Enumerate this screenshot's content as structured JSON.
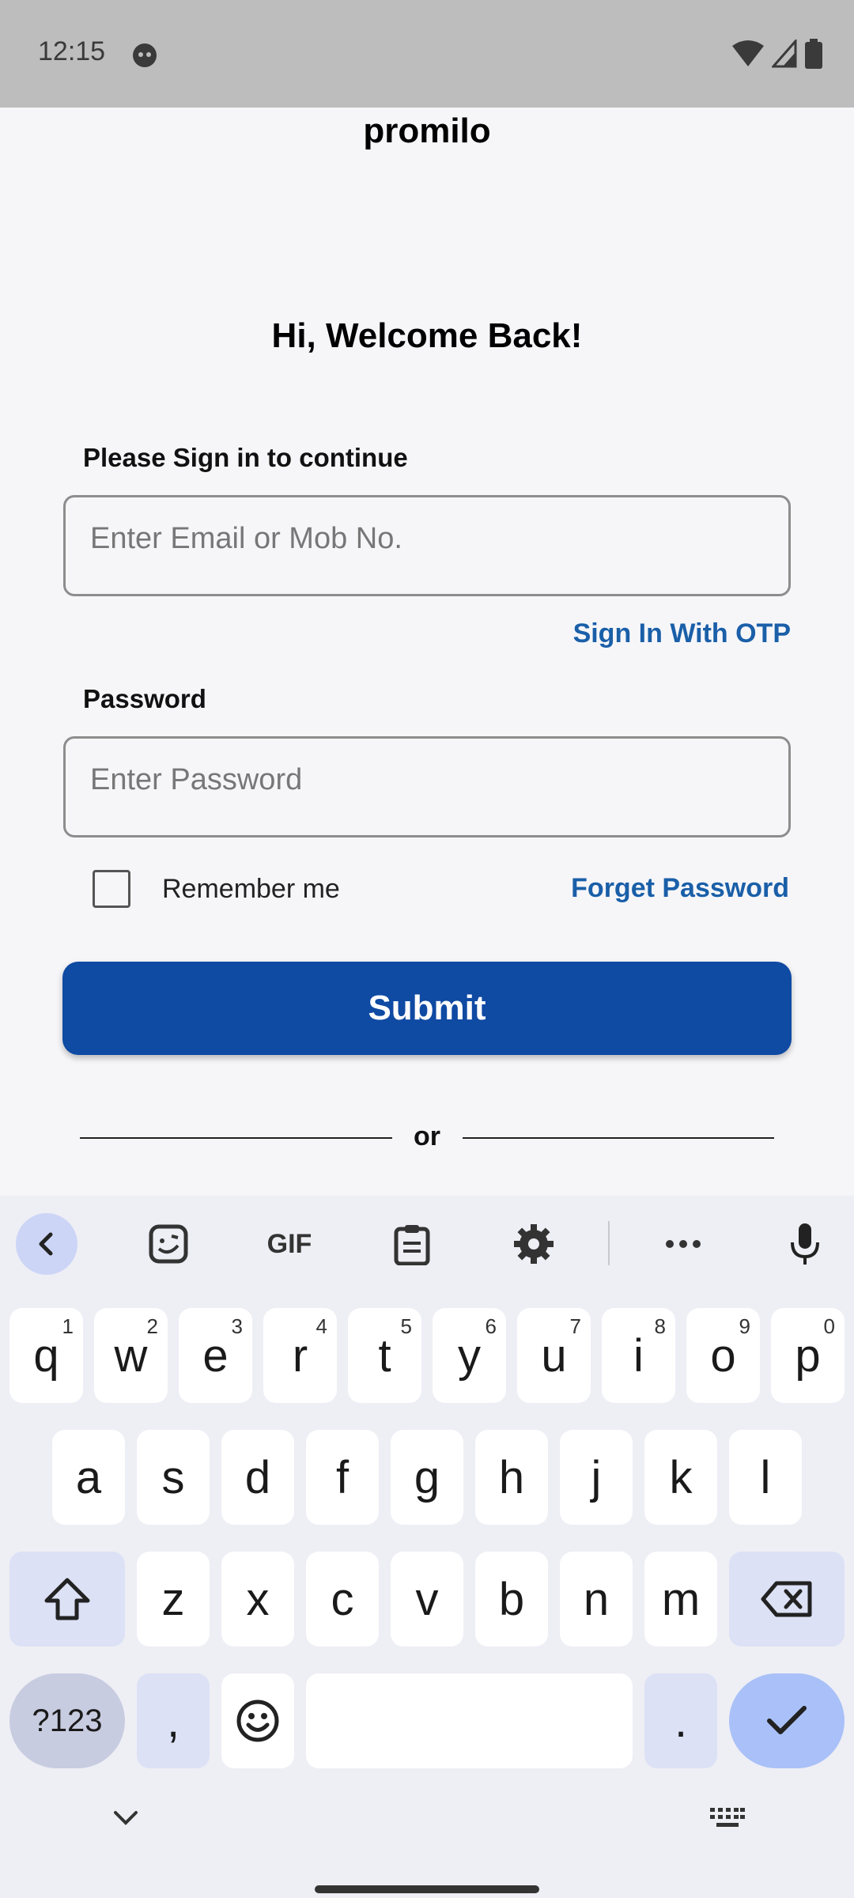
{
  "status_bar": {
    "time": "12:15"
  },
  "app": {
    "brand": "promilo",
    "welcome": "Hi, Welcome Back!",
    "signin_label": "Please Sign in to continue",
    "email_placeholder": "Enter Email or Mob No.",
    "otp_link": "Sign In With OTP",
    "password_label": "Password",
    "password_placeholder": "Enter Password",
    "remember_label": "Remember me",
    "forget_link": "Forget Password",
    "submit_label": "Submit",
    "or_text": "or",
    "colors": {
      "primary": "#0f4aa3",
      "link": "#1a5fa8"
    }
  },
  "keyboard": {
    "toolbar": [
      "back-chevron-icon",
      "sticker-icon",
      "GIF",
      "clipboard-icon",
      "settings-gear-icon",
      "more-icon",
      "microphone-icon"
    ],
    "row1": [
      {
        "k": "q",
        "h": "1"
      },
      {
        "k": "w",
        "h": "2"
      },
      {
        "k": "e",
        "h": "3"
      },
      {
        "k": "r",
        "h": "4"
      },
      {
        "k": "t",
        "h": "5"
      },
      {
        "k": "y",
        "h": "6"
      },
      {
        "k": "u",
        "h": "7"
      },
      {
        "k": "i",
        "h": "8"
      },
      {
        "k": "o",
        "h": "9"
      },
      {
        "k": "p",
        "h": "0"
      }
    ],
    "row2": [
      "a",
      "s",
      "d",
      "f",
      "g",
      "h",
      "j",
      "k",
      "l"
    ],
    "row3": [
      "z",
      "x",
      "c",
      "v",
      "b",
      "n",
      "m"
    ],
    "sym_label": "?123",
    "comma": ",",
    "period": "."
  }
}
